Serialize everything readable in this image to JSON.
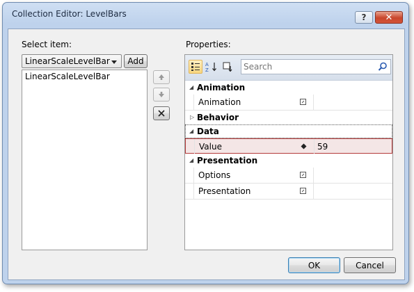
{
  "window": {
    "title": "Collection Editor: LevelBars",
    "help_label": "?",
    "close_label": "✕"
  },
  "left": {
    "select_item_label": "Select item:",
    "combo_value": "LinearScaleLevelBar",
    "add_label": "Add",
    "items": [
      "LinearScaleLevelBar"
    ]
  },
  "properties": {
    "label": "Properties:",
    "search_placeholder": "Search",
    "categories": [
      {
        "name": "Animation",
        "expanded": true,
        "props": [
          {
            "name": "Animation",
            "value": ""
          }
        ]
      },
      {
        "name": "Behavior",
        "expanded": false,
        "props": []
      },
      {
        "name": "Data",
        "expanded": true,
        "props": [
          {
            "name": "Value",
            "value": "59"
          }
        ]
      },
      {
        "name": "Presentation",
        "expanded": true,
        "props": [
          {
            "name": "Options",
            "value": ""
          },
          {
            "name": "Presentation",
            "value": ""
          }
        ]
      }
    ]
  },
  "footer": {
    "ok_label": "OK",
    "cancel_label": "Cancel"
  },
  "colors": {
    "selection_border": "#b33a3a",
    "selection_fill": "#f4e6e6",
    "title_bar": "#bed2ec"
  }
}
